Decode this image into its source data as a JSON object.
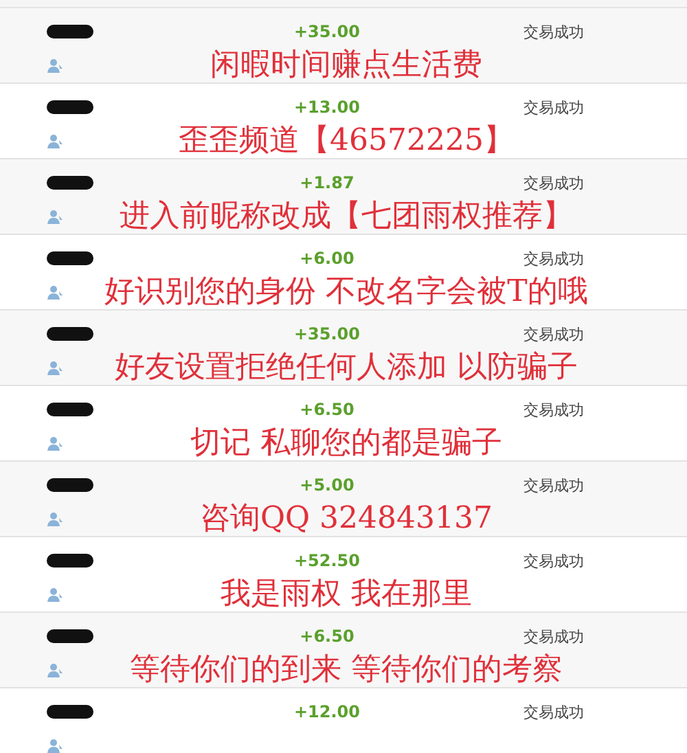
{
  "transactions": [
    {
      "amount": "+35.00",
      "status": "交易成功",
      "caption": "闲暇时间赚点生活费"
    },
    {
      "amount": "+13.00",
      "status": "交易成功",
      "caption": "歪歪频道【46572225】"
    },
    {
      "amount": "+1.87",
      "status": "交易成功",
      "caption": "进入前昵称改成【七团雨权推荐】"
    },
    {
      "amount": "+6.00",
      "status": "交易成功",
      "caption": "好识别您的身份 不改名字会被T的哦"
    },
    {
      "amount": "+35.00",
      "status": "交易成功",
      "caption": "好友设置拒绝任何人添加 以防骗子"
    },
    {
      "amount": "+6.50",
      "status": "交易成功",
      "caption": "切记 私聊您的都是骗子"
    },
    {
      "amount": "+5.00",
      "status": "交易成功",
      "caption": "咨询QQ 324843137"
    },
    {
      "amount": "+52.50",
      "status": "交易成功",
      "caption": "我是雨权 我在那里"
    },
    {
      "amount": "+6.50",
      "status": "交易成功",
      "caption": "等待你们的到来 等待你们的考察"
    },
    {
      "amount": "+12.00",
      "status": "交易成功"
    }
  ]
}
